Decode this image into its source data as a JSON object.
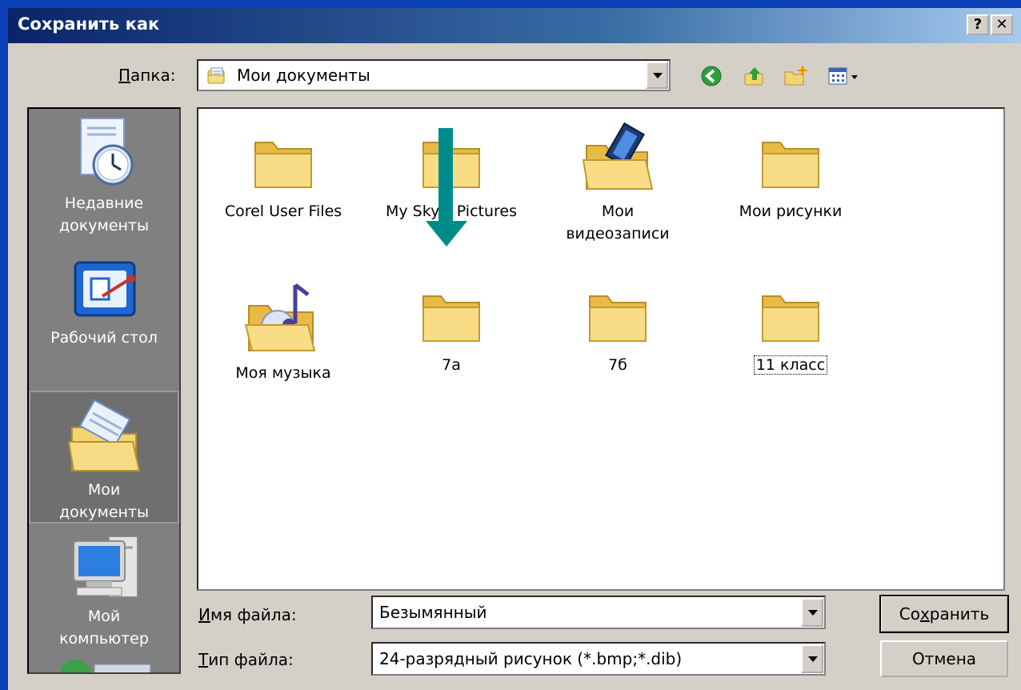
{
  "window": {
    "title": "Сохранить как",
    "help_label": "?",
    "close_label": "✕"
  },
  "location": {
    "label_prefix": "П",
    "label_rest": "апка:",
    "value": "Мои документы"
  },
  "places": [
    {
      "label_line1": "Недавние",
      "label_line2": "документы",
      "icon": "recent-documents-icon"
    },
    {
      "label_line1": "Рабочий стол",
      "label_line2": "",
      "icon": "desktop-icon"
    },
    {
      "label_line1": "Мои",
      "label_line2": "документы",
      "icon": "my-documents-icon"
    },
    {
      "label_line1": "Мой",
      "label_line2": "компьютер",
      "icon": "my-computer-icon"
    }
  ],
  "items": [
    {
      "label_line1": "Corel User Files",
      "label_line2": "",
      "icon": "folder-icon"
    },
    {
      "label_line1": "My Sky... Pictures",
      "label_line2": "",
      "icon": "folder-icon"
    },
    {
      "label_line1": "Мои",
      "label_line2": "видеозаписи",
      "icon": "video-folder-icon"
    },
    {
      "label_line1": "Мои рисунки",
      "label_line2": "",
      "icon": "folder-icon"
    },
    {
      "label_line1": "Моя музыка",
      "label_line2": "",
      "icon": "music-folder-icon"
    },
    {
      "label_line1": "7а",
      "label_line2": "",
      "icon": "folder-icon"
    },
    {
      "label_line1": "7б",
      "label_line2": "",
      "icon": "folder-icon"
    },
    {
      "label_line1": "11 класс",
      "label_line2": "",
      "icon": "folder-icon"
    }
  ],
  "filename": {
    "label_prefix": "И",
    "label_rest": "мя файла:",
    "value": "Безымянный"
  },
  "filetype": {
    "label_prefix": "Т",
    "label_rest": "ип файла:",
    "value": "24-разрядный рисунок (*.bmp;*.dib)"
  },
  "buttons": {
    "save_pre": "Со",
    "save_u": "х",
    "save_post": "ранить",
    "cancel": "Отмена"
  },
  "colors": {
    "annotation_arrow": "#008b8b",
    "desktop_bg": "#0a3fb5"
  }
}
